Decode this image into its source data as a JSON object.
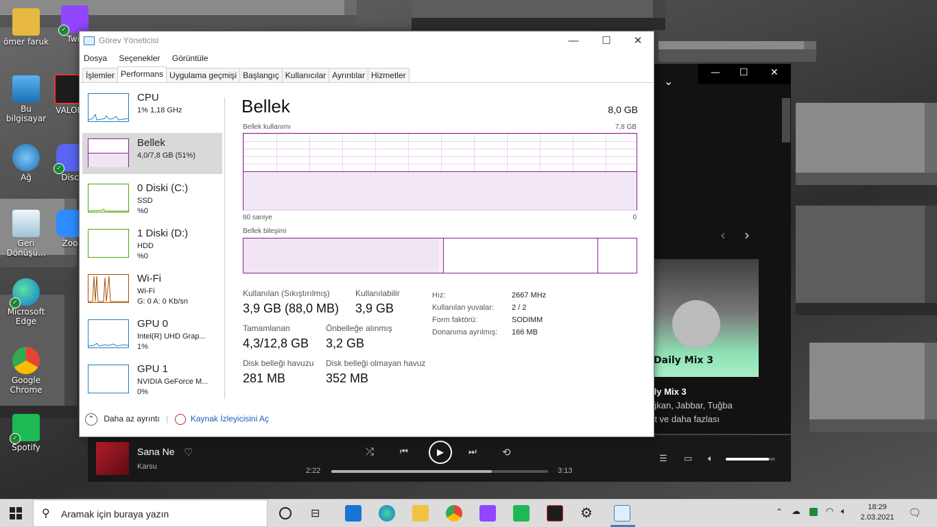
{
  "desktop": {
    "icons": [
      {
        "label": "ömer faruk"
      },
      {
        "label": "Twit"
      },
      {
        "label": "Bu bilgisayar"
      },
      {
        "label": "VALOR"
      },
      {
        "label": "Ağ"
      },
      {
        "label": "Disc"
      },
      {
        "label": "Geri Dönüşü..."
      },
      {
        "label": "Zoo"
      },
      {
        "label": "Microsoft Edge"
      },
      {
        "label": "Google Chrome"
      },
      {
        "label": "Spotify"
      }
    ]
  },
  "spotify": {
    "card_title": "Daily Mix 3",
    "section_title": "ily Mix 3",
    "artists_line1": "ğkan, Jabbar, Tuğba",
    "artists_line2": "rt ve daha fazlası",
    "track": "Sana Ne",
    "artist": "Karsu",
    "elapsed": "2:22",
    "duration": "3:13",
    "progress": 0.74,
    "volume": 0.88
  },
  "taskmgr": {
    "title": "Görev Yöneticisi",
    "menu": [
      "Dosya",
      "Seçenekler",
      "Görüntüle"
    ],
    "tabs": [
      "İşlemler",
      "Performans",
      "Uygulama geçmişi",
      "Başlangıç",
      "Kullanıcılar",
      "Ayrıntılar",
      "Hizmetler"
    ],
    "sidebar": [
      {
        "name": "CPU",
        "sub1": "1% 1,18 GHz",
        "sub2": ""
      },
      {
        "name": "Bellek",
        "sub1": "4,0/7,8 GB (51%)",
        "sub2": ""
      },
      {
        "name": "0 Diski (C:)",
        "sub1": "SSD",
        "sub2": "%0"
      },
      {
        "name": "1 Diski (D:)",
        "sub1": "HDD",
        "sub2": "%0"
      },
      {
        "name": "Wi-Fi",
        "sub1": "Wi-Fi",
        "sub2": "G: 0 A: 0 Kb/sn"
      },
      {
        "name": "GPU 0",
        "sub1": "Intel(R) UHD Grap...",
        "sub2": "1%"
      },
      {
        "name": "GPU 1",
        "sub1": "NVIDIA GeForce M...",
        "sub2": "0%"
      }
    ],
    "main": {
      "heading": "Bellek",
      "total": "8,0 GB",
      "usage_label": "Bellek kullanımı",
      "usage_max": "7,8 GB",
      "time_left": "60 saniye",
      "time_right": "0",
      "composition_label": "Bellek bileşimi",
      "stats": [
        {
          "label": "Kullanılan (Sıkıştırılmış)",
          "value": "3,9 GB (88,0 MB)"
        },
        {
          "label": "Kullanılabilir",
          "value": "3,9 GB"
        },
        {
          "label": "Tamamlanan",
          "value": "4,3/12,8 GB"
        },
        {
          "label": "Önbelleğe alınmış",
          "value": "3,2 GB"
        },
        {
          "label": "Disk belleği havuzu",
          "value": "281 MB"
        },
        {
          "label": "Disk belleği olmayan havuz",
          "value": "352 MB"
        }
      ],
      "details": [
        {
          "key": "Hız:",
          "value": "2667 MHz"
        },
        {
          "key": "Kullanılan yuvalar:",
          "value": "2 / 2"
        },
        {
          "key": "Form faktörü:",
          "value": "SODIMM"
        },
        {
          "key": "Donanıma ayrılmış:",
          "value": "166 MB"
        }
      ]
    },
    "footer": {
      "less": "Daha az ayrıntı",
      "monitor": "Kaynak İzleyicisini Aç"
    }
  },
  "taskbar": {
    "search_placeholder": "Aramak için buraya yazın",
    "time": "18:29",
    "date": "2.03.2021"
  }
}
